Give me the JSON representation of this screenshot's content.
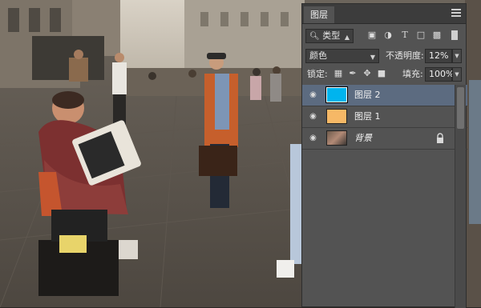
{
  "panel": {
    "tab_label": "图层",
    "filter_kind": "类型",
    "blend_mode": "颜色",
    "opacity_label": "不透明度:",
    "opacity_value": "12%",
    "lock_label": "锁定:",
    "fill_label": "填充:",
    "fill_value": "100%"
  },
  "layers": [
    {
      "name": "图层 2",
      "thumb_color": "#00b4ee",
      "selected": true
    },
    {
      "name": "图层 1",
      "thumb_color": "#f6b866",
      "selected": false
    },
    {
      "name": "背景",
      "selected": false,
      "locked": true
    }
  ],
  "icons": {
    "filter": "search-icon",
    "pixel_filter": "image-icon",
    "adjustment_filter": "half-circle-icon",
    "type_filter": "text-icon",
    "shape_filter": "shape-icon",
    "smart_filter": "smart-object-icon",
    "filter_toggle": "toggle-icon",
    "lock_transparent": "checkerboard-icon",
    "lock_image": "brush-icon",
    "lock_position": "move-icon",
    "lock_all": "lock-icon",
    "visibility": "eye-icon"
  },
  "colors": {
    "panel_bg": "#535353",
    "selected_layer": "#5c6b80",
    "layer2_fill": "#00b4ee",
    "layer1_fill": "#f6b866"
  }
}
